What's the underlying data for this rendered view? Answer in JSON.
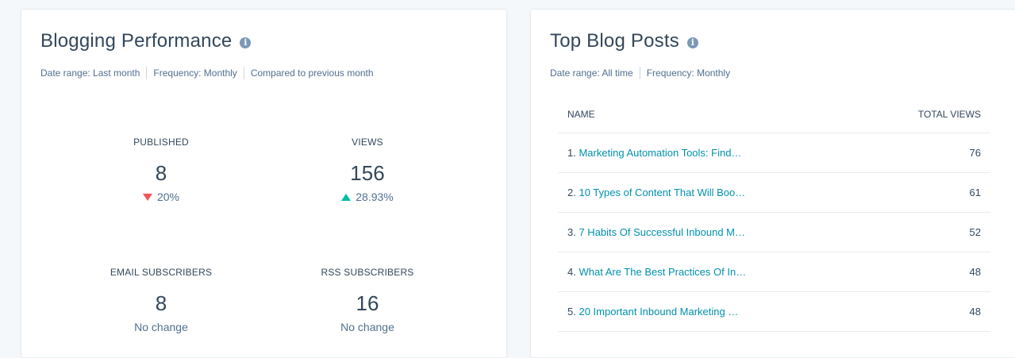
{
  "left_card": {
    "title": "Blogging Performance",
    "meta": [
      "Date range:  Last month",
      "Frequency:  Monthly",
      "Compared to previous month"
    ],
    "stats": [
      {
        "label": "PUBLISHED",
        "value": "8",
        "change": "20%",
        "trend": "down"
      },
      {
        "label": "VIEWS",
        "value": "156",
        "change": "28.93%",
        "trend": "up"
      },
      {
        "label": "EMAIL SUBSCRIBERS",
        "value": "8",
        "change": "No change",
        "trend": "none"
      },
      {
        "label": "RSS SUBSCRIBERS",
        "value": "16",
        "change": "No change",
        "trend": "none"
      }
    ]
  },
  "right_card": {
    "title": "Top Blog Posts",
    "meta": [
      "Date range:  All time",
      "Frequency:  Monthly"
    ],
    "columns": [
      "NAME",
      "TOTAL VIEWS"
    ],
    "rows": [
      {
        "rank": "1.",
        "name": "Marketing Automation Tools: Find…",
        "views": "76"
      },
      {
        "rank": "2.",
        "name": "10 Types of Content That Will Boo…",
        "views": "61"
      },
      {
        "rank": "3.",
        "name": "7 Habits Of Successful Inbound M…",
        "views": "52"
      },
      {
        "rank": "4.",
        "name": "What Are The Best Practices Of In…",
        "views": "48"
      },
      {
        "rank": "5.",
        "name": "20 Important Inbound Marketing …",
        "views": "48"
      }
    ]
  },
  "colors": {
    "accent_link": "#0091ae",
    "down": "#f2545b",
    "up": "#00bda5",
    "text": "#33475b"
  },
  "icons": {
    "info": "info-icon",
    "trend_down": "trend-down-icon",
    "trend_up": "trend-up-icon"
  }
}
